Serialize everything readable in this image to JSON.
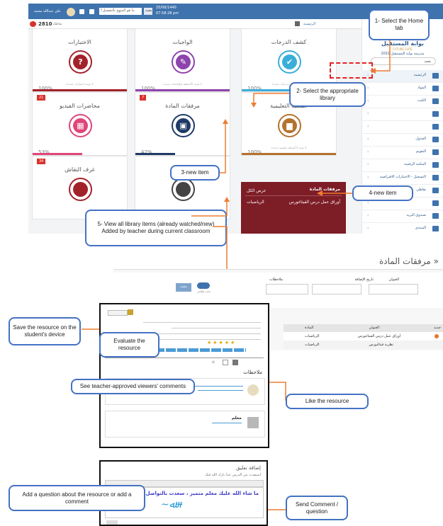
{
  "app": {
    "user_name": "علي عبدالله محمد",
    "search_placeholder": "ما هو المنهج بالتفصيل؟",
    "search_btn": "بحث",
    "date": "25/06/1440",
    "time": "07:58:28 pm",
    "points_value": "2810",
    "points_label": "نقاطك",
    "breadcrumb": "الرئيسية",
    "logo_title": "بوابة المستقبل",
    "logo_sub": "FUTURE GATE",
    "school": "مدرسة بوابة المستقبل 2019",
    "side_search": "بحث",
    "menu": [
      {
        "label": "الرئيسية",
        "active": true
      },
      {
        "label": "المواد",
        "active": false
      },
      {
        "label": "الكتب",
        "active": false
      },
      {
        "label": "",
        "active": false
      },
      {
        "label": "",
        "active": false
      },
      {
        "label": "الجدول",
        "active": false
      },
      {
        "label": "التقويم",
        "active": false
      },
      {
        "label": "المكتبة الرقمية",
        "active": false
      },
      {
        "label": "التسجيل - الاختبارات الافتراضية",
        "active": false
      },
      {
        "label": "نقاطي",
        "active": false
      },
      {
        "label": "",
        "active": false
      },
      {
        "label": "صندوق البريد",
        "active": false
      },
      {
        "label": "المنتدى",
        "active": false
      }
    ],
    "cards": [
      {
        "title": "كشف الدرجات",
        "sub": "لا توجد ملفات درجات جديدة",
        "pct": "100%",
        "icon": "✔",
        "color": "#3aaed8",
        "badge": ""
      },
      {
        "title": "الواجبات",
        "sub": "لا توجد الأنشطة والواجبات جديدة",
        "pct": "100%",
        "icon": "✎",
        "color": "#8e44ad",
        "badge": ""
      },
      {
        "title": "الاختبارات",
        "sub": "لا توجد اختبارات جديدة",
        "pct": "100%",
        "icon": "?",
        "color": "#a3222a",
        "badge": ""
      },
      {
        "title": "المكتبة التعليمية",
        "sub": "لا توجد الأنشطة تعليمية جديدة",
        "pct": "100%",
        "icon": "▆",
        "color": "#b5722e",
        "badge": ""
      },
      {
        "title": "مرفقات المادة",
        "sub": "",
        "pct": "42%",
        "icon": "▣",
        "color": "#1f3a66",
        "badge": "7"
      },
      {
        "title": "محاضرات الفيديو",
        "sub": "",
        "pct": "53%",
        "icon": "▦",
        "color": "#e0457b",
        "badge": "21"
      },
      {
        "title": "غرف النقاش",
        "sub": "",
        "pct": "",
        "icon": "",
        "color": "#a3222a",
        "badge": "34"
      },
      {
        "title": "",
        "sub": "",
        "pct": "",
        "icon": "",
        "color": "#444",
        "badge": ""
      }
    ],
    "popup": {
      "title": "مرفقات المادة",
      "col2": "عرض الكل",
      "item": "أوراق عمل درس الفيثاغورس",
      "item_subject": "الرياضيات"
    }
  },
  "callouts": {
    "c1": "1- Select the Home tab",
    "c2": "2- Select the appropriate library",
    "c3": "3-new item",
    "c4": "4-new item",
    "c5": "5- View all library items (already watched/new) Added by teacher during current classroom",
    "c6": "Save the resource on the student's device",
    "c7": "Evaluate the resource",
    "c8": "See teacher-approved viewers' comments",
    "c9": "Like the resource",
    "c10": "Add a question about the resource or add a comment",
    "c11": "Send Comment / question"
  },
  "library": {
    "title": "مرفقات المادة »",
    "f_title": "العنوان",
    "f_date": "تاريخ الإضافة",
    "f_notes": "ملاحظات",
    "toggle_label": "بحث تلقائي",
    "search_btn": "بحث",
    "col_new": "جديد",
    "col_title": "العنوان",
    "col_subject": "المادة",
    "rows": [
      {
        "title": "أوراق عمل درس الفيثاغورس",
        "subject": "الرياضيات"
      },
      {
        "title": "نظرية فيثاغورس",
        "subject": "الرياضيات"
      }
    ]
  },
  "detail": {
    "comments_title": "ملاحظات",
    "commenter": "معلم",
    "add_comment_title": "إضافة تعليق",
    "comment_text": "ما شاء الله عليك معلم متميز ، سعدت بالتواصل معك",
    "comment_hint": "استفدت من الدرس جدا بارك الله فيك"
  }
}
